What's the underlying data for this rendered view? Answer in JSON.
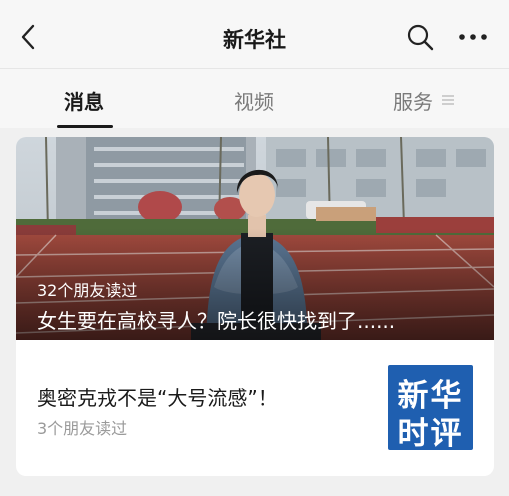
{
  "header": {
    "title": "新华社",
    "back_icon": "chevron-left-icon",
    "search_icon": "search-icon",
    "more_icon": "more-dots-icon"
  },
  "tabs": [
    {
      "label": "消息",
      "active": true
    },
    {
      "label": "视频",
      "active": false
    },
    {
      "label": "服务",
      "active": false,
      "icon": "menu-lines-icon"
    }
  ],
  "featured": {
    "readers": "32个朋友读过",
    "title": "女生要在高校寻人？院长很快找到了......"
  },
  "article": {
    "title": "奥密克戎不是“大号流感”！",
    "readers": "3个朋友读过",
    "thumb_line1": "新华",
    "thumb_line2": "时评",
    "thumb_color": "#1f5fb0"
  }
}
